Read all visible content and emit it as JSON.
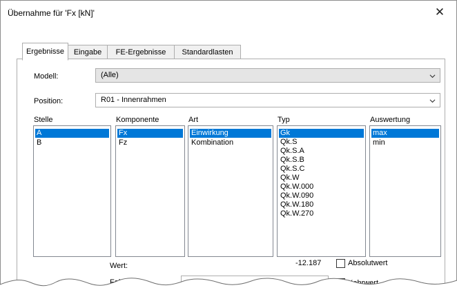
{
  "dialog": {
    "title": "Übernahme für 'Fx [kN]'",
    "close_glyph": "✕"
  },
  "tabs": [
    {
      "label": "Ergebnisse",
      "active": true
    },
    {
      "label": "Eingabe",
      "active": false
    },
    {
      "label": "FE-Ergebnisse",
      "active": false
    },
    {
      "label": "Standardlasten",
      "active": false
    }
  ],
  "modell": {
    "label": "Modell:",
    "value": "(Alle)"
  },
  "position": {
    "label": "Position:",
    "value": "R01 - Innenrahmen"
  },
  "lists": {
    "stelle": {
      "header": "Stelle",
      "items": [
        "A",
        "B"
      ],
      "selected": 0
    },
    "komponente": {
      "header": "Komponente",
      "items": [
        "Fx",
        "Fz"
      ],
      "selected": 0
    },
    "art": {
      "header": "Art",
      "items": [
        "Einwirkung",
        "Kombination"
      ],
      "selected": 0
    },
    "typ": {
      "header": "Typ",
      "items": [
        "Gk",
        "Qk.S",
        "Qk.S.A",
        "Qk.S.B",
        "Qk.S.C",
        "Qk.W",
        "Qk.W.000",
        "Qk.W.090",
        "Qk.W.180",
        "Qk.W.270"
      ],
      "selected": 0
    },
    "auswertung": {
      "header": "Auswertung",
      "items": [
        "max",
        "min"
      ],
      "selected": 0
    }
  },
  "wert": {
    "label": "Wert:",
    "value": "-12.187"
  },
  "absolutwert": {
    "label": "Absolutwert",
    "checked": false
  },
  "faktor": {
    "label": "Faktor:",
    "value": ""
  },
  "kehrwert": {
    "label": "Kehrwert",
    "checked": false
  },
  "colors": {
    "selection": "#0078d7",
    "combo_grey": "#e5e5e5",
    "border": "#adadad"
  }
}
